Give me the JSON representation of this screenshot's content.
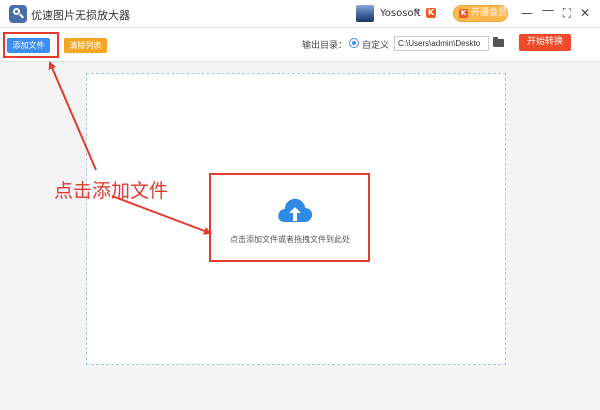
{
  "titlebar": {
    "app_title": "优速图片无损放大器",
    "username": "Yososoft",
    "chevron": "∨",
    "badge": "K",
    "vip_label": "开通会员",
    "win_menu": "—",
    "win_minimize": "—",
    "win_maximize": "⛶",
    "win_close": "✕"
  },
  "toolbar": {
    "add_file_label": "添加文件",
    "clear_list_label": "清除列表",
    "output_dir_label": "输出目录：",
    "custom_label": "自定义",
    "path_value": "C:\\Users\\admin\\Deskto",
    "convert_label": "开始转换"
  },
  "drop_area": {
    "hint": "点击添加文件或者拖拽文件到此处"
  },
  "annotation": {
    "text": "点击添加文件"
  },
  "colors": {
    "accent_blue": "#3d8ef0",
    "clear_orange": "#f5a623",
    "convert_red": "#f04a2a",
    "annotation_red": "#e23b2e"
  }
}
